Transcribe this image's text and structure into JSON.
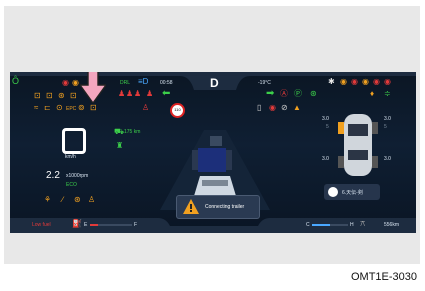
{
  "header": {
    "time": "00:58",
    "gear": "D",
    "outside_temp": "-19°C"
  },
  "speed": {
    "value": "0",
    "unit": "km/h"
  },
  "rpm": {
    "value": "2.2",
    "unit": "x1000rpm",
    "mode": "ECO"
  },
  "indicators_left": {
    "epc_label": "EPC"
  },
  "speed_limit": {
    "value": "110"
  },
  "lane_assist": {
    "label": "175 km"
  },
  "center": {
    "warning_message": "Connecting trailer"
  },
  "media": {
    "track": "6.天伝-剣"
  },
  "tyres": {
    "front_left": "3.0",
    "front_right": "3.0",
    "rear_left": "3.0",
    "rear_right": "3.0",
    "unit": "bar",
    "temp_left_front": "5",
    "temp_right_front": "5"
  },
  "footer": {
    "left_label": "Low fuel",
    "fuel_e": "E",
    "fuel_f": "F",
    "temp_c": "C",
    "temp_h": "H",
    "range": "556km"
  },
  "caption": "OMT1E-3030",
  "colors": {
    "warning_red": "#e23a3a",
    "indicator_green": "#3ccf4a",
    "indicator_amber": "#f0a020",
    "highlight_arrow": "#f4a6bf"
  }
}
